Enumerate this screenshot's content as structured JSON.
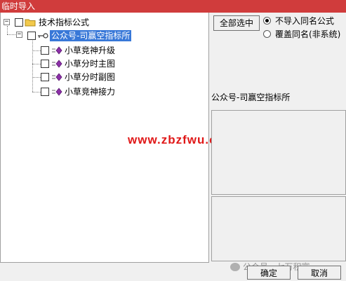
{
  "window": {
    "title": "临时导入"
  },
  "tree": {
    "root": {
      "label": "技术指标公式",
      "expander": "−"
    },
    "group": {
      "label": "公众号-司赢空指标所",
      "expander": "−"
    },
    "items": [
      {
        "label": "小草竞神升级"
      },
      {
        "label": "小草分时主图"
      },
      {
        "label": "小草分时副图"
      },
      {
        "label": "小草竞神接力"
      }
    ]
  },
  "controls": {
    "select_all_label": "全部选中",
    "radio_options": [
      {
        "label": "不导入同名公式",
        "selected": true
      },
      {
        "label": "覆盖同名(非系统)",
        "selected": false
      }
    ]
  },
  "description": {
    "title": "公众号-司赢空指标所"
  },
  "watermark": {
    "text": "www.zbzfwu.com",
    "color": "#e01818"
  },
  "footer": {
    "ok_label": "确定",
    "cancel_label": "取消",
    "brand_text": "公众号 · 七万积富"
  },
  "colors": {
    "titlebar": "#d03c3c",
    "selection": "#3878d8",
    "folder": "#f2c94c",
    "formula": "#8c2fa8"
  }
}
